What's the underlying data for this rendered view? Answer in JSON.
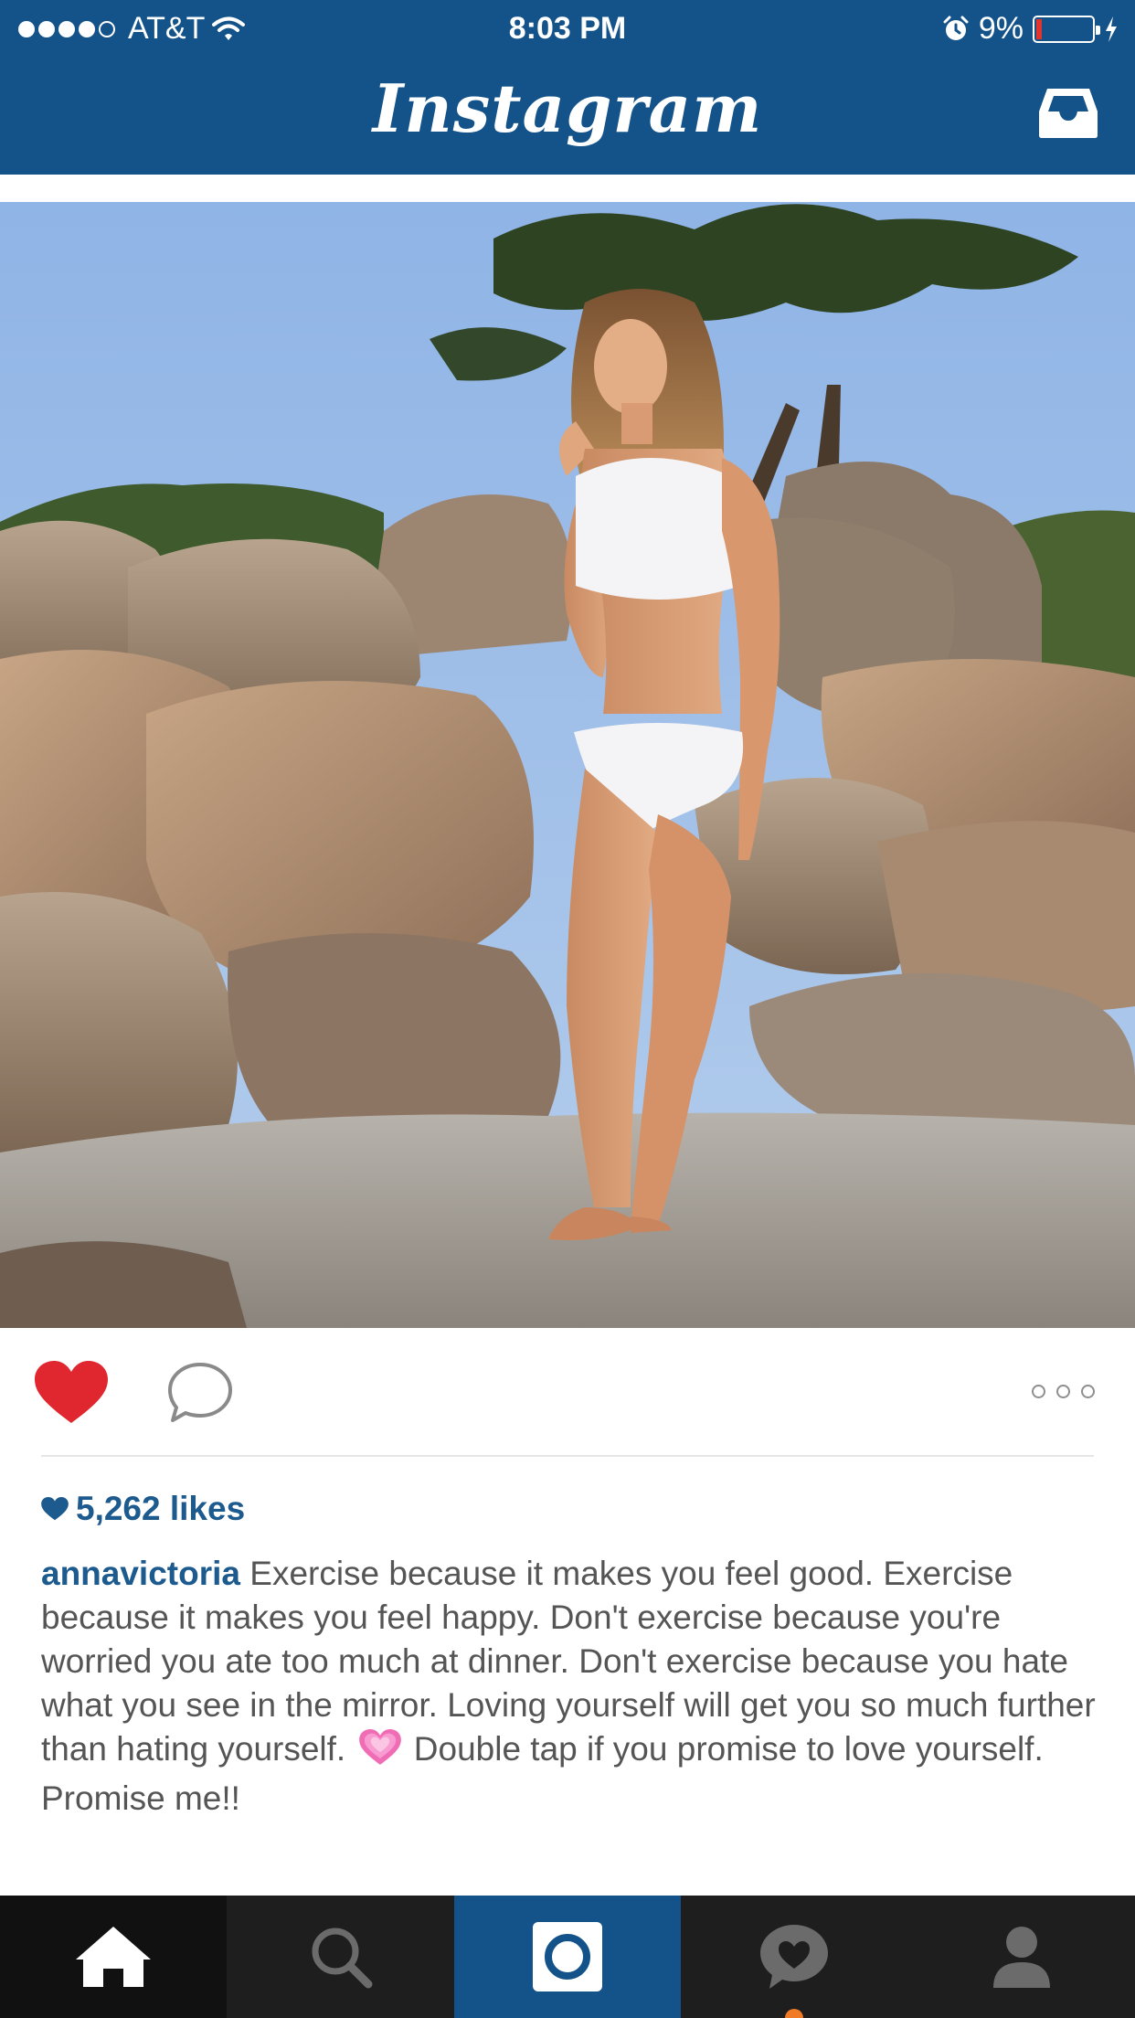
{
  "status_bar": {
    "carrier": "AT&T",
    "time": "8:03 PM",
    "battery_percent": "9%",
    "battery_level": 0.09,
    "signal_bars_filled": 4,
    "signal_bars_total": 5
  },
  "header": {
    "app_title": "Instagram",
    "inbox_icon": "inbox-tray-icon",
    "background_color": "#14538a"
  },
  "post": {
    "image_alt": "Woman in white swimwear standing barefoot among granite boulders on a beach at sunset",
    "liked": true,
    "likes_text": "5,262 likes",
    "username": "annavictoria",
    "caption_part1": " Exercise because it makes you feel good. Exercise because it makes you feel happy. Don't exercise because you're worried you ate too much at dinner. Don't exercise because you hate what you see in the mirror. Loving yourself will get you so much further than hating yourself. ",
    "caption_emoji_icon": "growing-heart-emoji-icon",
    "caption_part2": " Double tap if you promise to love yourself. Promise me!!",
    "like_color": "#e0262e",
    "link_color": "#1d5a8e"
  },
  "tab_bar": {
    "tabs": [
      {
        "icon": "home-icon",
        "active": true
      },
      {
        "icon": "search-icon",
        "active": false
      },
      {
        "icon": "camera-icon",
        "active": false
      },
      {
        "icon": "activity-heart-bubble-icon",
        "active": false,
        "has_notification": true
      },
      {
        "icon": "profile-icon",
        "active": false
      }
    ],
    "camera_tab_color": "#14538a",
    "notification_color": "#f07a26"
  }
}
